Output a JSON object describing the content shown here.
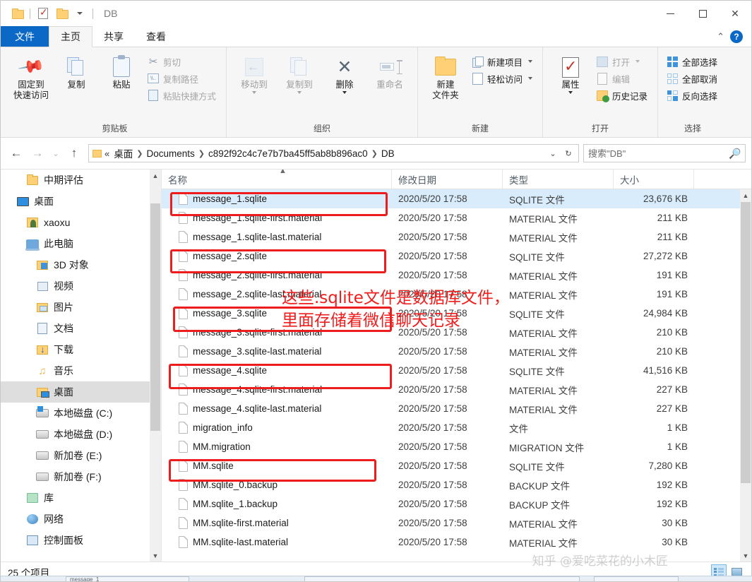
{
  "window": {
    "title": "DB",
    "quick_access_icons": [
      "folder-icon",
      "properties-icon",
      "folder-icon",
      "chevron-down-icon"
    ],
    "controls": {
      "minimize": "—",
      "maximize": "☐",
      "close": "✕"
    }
  },
  "tabs": [
    {
      "id": "file",
      "label": "文件",
      "state": "file-menu"
    },
    {
      "id": "home",
      "label": "主页",
      "state": "active"
    },
    {
      "id": "share",
      "label": "共享",
      "state": "normal"
    },
    {
      "id": "view",
      "label": "查看",
      "state": "normal"
    }
  ],
  "tab_right": {
    "collapse": "⌃",
    "help": "?"
  },
  "ribbon": {
    "groups": [
      {
        "name": "clipboard",
        "label": "剪贴板",
        "big_buttons": [
          {
            "name": "pin-to-quick-access",
            "label_line1": "固定到",
            "label_line2": "快速访问",
            "icon": "pin-icon",
            "disabled": false
          },
          {
            "name": "copy",
            "label_line1": "复制",
            "label_line2": "",
            "icon": "copy-icon",
            "disabled": false
          },
          {
            "name": "paste",
            "label_line1": "粘贴",
            "label_line2": "",
            "icon": "paste-icon",
            "disabled": false
          }
        ],
        "small_buttons": [
          {
            "name": "cut",
            "label": "剪切",
            "icon": "scissors-icon",
            "disabled": true
          },
          {
            "name": "copy-path",
            "label": "复制路径",
            "icon": "copy-path-icon",
            "disabled": true
          },
          {
            "name": "paste-shortcut",
            "label": "粘贴快捷方式",
            "icon": "paste-shortcut-icon",
            "disabled": true
          }
        ]
      },
      {
        "name": "organize",
        "label": "组织",
        "big_buttons": [
          {
            "name": "move-to",
            "label_line1": "移动到",
            "label_line2": "",
            "icon": "move-to-icon",
            "disabled": true,
            "dropdown": true
          },
          {
            "name": "copy-to",
            "label_line1": "复制到",
            "label_line2": "",
            "icon": "copy-to-icon",
            "disabled": true,
            "dropdown": true
          },
          {
            "name": "delete",
            "label_line1": "删除",
            "label_line2": "",
            "icon": "delete-x-icon",
            "disabled": false,
            "dropdown": true
          },
          {
            "name": "rename",
            "label_line1": "重命名",
            "label_line2": "",
            "icon": "rename-icon",
            "disabled": true
          }
        ],
        "small_buttons": []
      },
      {
        "name": "new",
        "label": "新建",
        "big_buttons": [
          {
            "name": "new-folder",
            "label_line1": "新建",
            "label_line2": "文件夹",
            "icon": "new-folder-icon",
            "disabled": false
          }
        ],
        "small_buttons": [
          {
            "name": "new-item",
            "label": "新建项目",
            "icon": "new-item-icon",
            "disabled": false,
            "dropdown": true
          },
          {
            "name": "easy-access",
            "label": "轻松访问",
            "icon": "easy-access-icon",
            "disabled": false,
            "dropdown": true
          }
        ]
      },
      {
        "name": "open",
        "label": "打开",
        "big_buttons": [
          {
            "name": "properties",
            "label_line1": "属性",
            "label_line2": "",
            "icon": "properties-icon",
            "disabled": false,
            "dropdown": true
          }
        ],
        "small_buttons": [
          {
            "name": "open",
            "label": "打开",
            "icon": "open-icon",
            "disabled": true,
            "dropdown": true
          },
          {
            "name": "edit",
            "label": "编辑",
            "icon": "edit-icon",
            "disabled": true
          },
          {
            "name": "history",
            "label": "历史记录",
            "icon": "history-icon",
            "disabled": false
          }
        ]
      },
      {
        "name": "select",
        "label": "选择",
        "big_buttons": [],
        "small_buttons": [
          {
            "name": "select-all",
            "label": "全部选择",
            "icon": "select-all-icon",
            "disabled": false
          },
          {
            "name": "select-none",
            "label": "全部取消",
            "icon": "select-none-icon",
            "disabled": false
          },
          {
            "name": "invert-selection",
            "label": "反向选择",
            "icon": "invert-selection-icon",
            "disabled": false
          }
        ]
      }
    ]
  },
  "addressbar": {
    "back": "←",
    "forward": "→",
    "recent": "⌄",
    "up": "↑",
    "prefix": "«",
    "crumbs": [
      "桌面",
      "Documents",
      "c892f92c4c7e7b7ba45ff5ab8b896ac0",
      "DB"
    ],
    "crumb_dropdown": "⌄",
    "refresh": "↻",
    "search_placeholder": "搜索\"DB\"",
    "search_value": "",
    "search_icon": "search-icon"
  },
  "sidebar": {
    "items": [
      {
        "label": "中期评估",
        "icon": "folder-icon",
        "indent": 2,
        "selected": false
      },
      {
        "label": "桌面",
        "icon": "monitor-icon",
        "indent": 1,
        "selected": false
      },
      {
        "label": "xaoxu",
        "icon": "user-folder-icon",
        "indent": 2,
        "selected": false
      },
      {
        "label": "此电脑",
        "icon": "this-pc-icon",
        "indent": 2,
        "selected": false
      },
      {
        "label": "3D 对象",
        "icon": "3d-objects-icon",
        "indent": 3,
        "selected": false
      },
      {
        "label": "视频",
        "icon": "videos-icon",
        "indent": 3,
        "selected": false
      },
      {
        "label": "图片",
        "icon": "pictures-icon",
        "indent": 3,
        "selected": false
      },
      {
        "label": "文档",
        "icon": "documents-icon",
        "indent": 3,
        "selected": false
      },
      {
        "label": "下载",
        "icon": "downloads-icon",
        "indent": 3,
        "selected": false
      },
      {
        "label": "音乐",
        "icon": "music-icon",
        "indent": 3,
        "selected": false
      },
      {
        "label": "桌面",
        "icon": "desktop-icon",
        "indent": 3,
        "selected": true
      },
      {
        "label": "本地磁盘 (C:)",
        "icon": "system-drive-icon",
        "indent": 3,
        "selected": false
      },
      {
        "label": "本地磁盘 (D:)",
        "icon": "drive-icon",
        "indent": 3,
        "selected": false
      },
      {
        "label": "新加卷 (E:)",
        "icon": "drive-icon",
        "indent": 3,
        "selected": false
      },
      {
        "label": "新加卷 (F:)",
        "icon": "drive-icon",
        "indent": 3,
        "selected": false
      },
      {
        "label": "库",
        "icon": "libraries-icon",
        "indent": 2,
        "selected": false
      },
      {
        "label": "网络",
        "icon": "network-icon",
        "indent": 2,
        "selected": false
      },
      {
        "label": "控制面板",
        "icon": "control-panel-icon",
        "indent": 2,
        "selected": false
      }
    ]
  },
  "filelist": {
    "columns": [
      {
        "key": "name",
        "label": "名称",
        "sorted": "asc"
      },
      {
        "key": "date",
        "label": "修改日期",
        "sorted": null
      },
      {
        "key": "type",
        "label": "类型",
        "sorted": null
      },
      {
        "key": "size",
        "label": "大小",
        "sorted": null
      }
    ],
    "rows": [
      {
        "name": "message_1.sqlite",
        "date": "2020/5/20 17:58",
        "type": "SQLITE 文件",
        "size": "23,676 KB",
        "selected": true,
        "highlighted": true
      },
      {
        "name": "message_1.sqlite-first.material",
        "date": "2020/5/20 17:58",
        "type": "MATERIAL 文件",
        "size": "211 KB",
        "selected": false,
        "highlighted": false
      },
      {
        "name": "message_1.sqlite-last.material",
        "date": "2020/5/20 17:58",
        "type": "MATERIAL 文件",
        "size": "211 KB",
        "selected": false,
        "highlighted": false
      },
      {
        "name": "message_2.sqlite",
        "date": "2020/5/20 17:58",
        "type": "SQLITE 文件",
        "size": "27,272 KB",
        "selected": false,
        "highlighted": true
      },
      {
        "name": "message_2.sqlite-first.material",
        "date": "2020/5/20 17:58",
        "type": "MATERIAL 文件",
        "size": "191 KB",
        "selected": false,
        "highlighted": false
      },
      {
        "name": "message_2.sqlite-last.material",
        "date": "2020/5/20 17:58",
        "type": "MATERIAL 文件",
        "size": "191 KB",
        "selected": false,
        "highlighted": false
      },
      {
        "name": "message_3.sqlite",
        "date": "2020/5/20 17:58",
        "type": "SQLITE 文件",
        "size": "24,984 KB",
        "selected": false,
        "highlighted": true
      },
      {
        "name": "message_3.sqlite-first.material",
        "date": "2020/5/20 17:58",
        "type": "MATERIAL 文件",
        "size": "210 KB",
        "selected": false,
        "highlighted": false
      },
      {
        "name": "message_3.sqlite-last.material",
        "date": "2020/5/20 17:58",
        "type": "MATERIAL 文件",
        "size": "210 KB",
        "selected": false,
        "highlighted": false
      },
      {
        "name": "message_4.sqlite",
        "date": "2020/5/20 17:58",
        "type": "SQLITE 文件",
        "size": "41,516 KB",
        "selected": false,
        "highlighted": true
      },
      {
        "name": "message_4.sqlite-first.material",
        "date": "2020/5/20 17:58",
        "type": "MATERIAL 文件",
        "size": "227 KB",
        "selected": false,
        "highlighted": false
      },
      {
        "name": "message_4.sqlite-last.material",
        "date": "2020/5/20 17:58",
        "type": "MATERIAL 文件",
        "size": "227 KB",
        "selected": false,
        "highlighted": false
      },
      {
        "name": "migration_info",
        "date": "2020/5/20 17:58",
        "type": "文件",
        "size": "1 KB",
        "selected": false,
        "highlighted": false
      },
      {
        "name": "MM.migration",
        "date": "2020/5/20 17:58",
        "type": "MIGRATION 文件",
        "size": "1 KB",
        "selected": false,
        "highlighted": false
      },
      {
        "name": "MM.sqlite",
        "date": "2020/5/20 17:58",
        "type": "SQLITE 文件",
        "size": "7,280 KB",
        "selected": false,
        "highlighted": true
      },
      {
        "name": "MM.sqlite_0.backup",
        "date": "2020/5/20 17:58",
        "type": "BACKUP 文件",
        "size": "192 KB",
        "selected": false,
        "highlighted": false
      },
      {
        "name": "MM.sqlite_1.backup",
        "date": "2020/5/20 17:58",
        "type": "BACKUP 文件",
        "size": "192 KB",
        "selected": false,
        "highlighted": false
      },
      {
        "name": "MM.sqlite-first.material",
        "date": "2020/5/20 17:58",
        "type": "MATERIAL 文件",
        "size": "30 KB",
        "selected": false,
        "highlighted": false
      },
      {
        "name": "MM.sqlite-last.material",
        "date": "2020/5/20 17:58",
        "type": "MATERIAL 文件",
        "size": "30 KB",
        "selected": false,
        "highlighted": false
      }
    ]
  },
  "annotation": {
    "color": "#f01d1d",
    "line1": "这些.sqlite文件是数据库文件，",
    "line2": "里面存储着微信聊天记录"
  },
  "statusbar": {
    "item_count": "25 个项目",
    "view_details": "details-view-icon",
    "view_thumbnails": "thumbnail-view-icon"
  },
  "watermark": {
    "text": "知乎 @爱吃菜花的小木匠"
  },
  "taskbar": {
    "item_label": "message_1"
  }
}
